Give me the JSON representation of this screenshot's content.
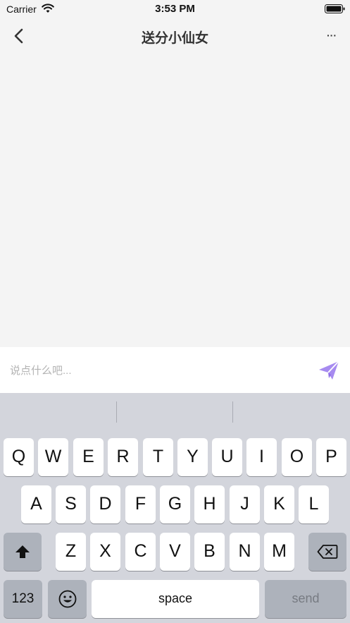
{
  "status_bar": {
    "carrier": "Carrier",
    "time": "3:53 PM",
    "wifi_icon": "wifi-icon",
    "battery_icon": "battery-icon"
  },
  "nav": {
    "title": "送分小仙女",
    "back_icon": "chevron-left-icon",
    "more_label": "···"
  },
  "composer": {
    "placeholder": "说点什么吧...",
    "value": "",
    "send_icon": "paper-plane-icon",
    "send_icon_color": "#a78bf0"
  },
  "keyboard": {
    "row1": [
      "Q",
      "W",
      "E",
      "R",
      "T",
      "Y",
      "U",
      "I",
      "O",
      "P"
    ],
    "row2": [
      "A",
      "S",
      "D",
      "F",
      "G",
      "H",
      "J",
      "K",
      "L"
    ],
    "row3": [
      "Z",
      "X",
      "C",
      "V",
      "B",
      "N",
      "M"
    ],
    "numbers_label": "123",
    "space_label": "space",
    "return_label": "send",
    "shift_icon": "shift-arrow-icon",
    "delete_icon": "backspace-icon",
    "emoji_icon": "emoji-icon"
  }
}
